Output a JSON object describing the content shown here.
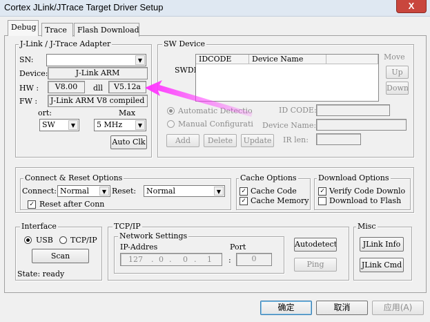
{
  "window": {
    "title": "Cortex JLink/JTrace Target Driver Setup",
    "close_glyph": "X"
  },
  "tabs": [
    {
      "label": "Debug",
      "active": true
    },
    {
      "label": "Trace",
      "active": false
    },
    {
      "label": "Flash Download",
      "active": false
    }
  ],
  "adapter": {
    "group_label": "J-Link / J-Trace Adapter",
    "sn_label": "SN:",
    "sn_value": "",
    "device_label": "Device:",
    "device_value": "J-Link ARM",
    "hw_label": "HW :",
    "hw_value": "V8.00",
    "dll_label": "dll",
    "dll_value": "V5.12a",
    "fw_label": "FW :",
    "fw_value": "J-Link ARM V8 compiled I",
    "port_label": "ort:",
    "port_value": "SW",
    "max_label": "Max",
    "max_value": "5 MHz",
    "auto_clk": "Auto Clk"
  },
  "sw_device": {
    "group_label": "SW Device",
    "swdio_label": "SWDI(",
    "columns": [
      "IDCODE",
      "Device Name"
    ],
    "move_label": "Move",
    "up_button": "Up",
    "down_button": "Down",
    "automatic_detection": "Automatic Detectio",
    "manual_configuration": "Manual Configurati",
    "detection_mode": "automatic",
    "idcode_label": "ID CODE:",
    "device_name_label": "Device Name:",
    "ir_len_label": "IR len:",
    "add_button": "Add",
    "delete_button": "Delete",
    "update_button": "Update"
  },
  "connect": {
    "group_label": "Connect & Reset Options",
    "connect_label": "Connect:",
    "connect_value": "Normal",
    "reset_label": "Reset:",
    "reset_value": "Normal",
    "reset_after_connect": "Reset after Conn",
    "reset_after_connect_checked": true
  },
  "cache": {
    "group_label": "Cache Options",
    "cache_code": "Cache Code",
    "cache_code_checked": true,
    "cache_memory": "Cache Memory",
    "cache_memory_checked": true
  },
  "download": {
    "group_label": "Download Options",
    "verify": "Verify Code Downlo",
    "verify_checked": true,
    "download_to_flash": "Download to Flash",
    "download_to_flash_checked": false
  },
  "interface": {
    "group_label": "Interface",
    "usb": "USB",
    "tcpip": "TCP/IP",
    "selected": "USB",
    "scan": "Scan",
    "state": "State: ready"
  },
  "tcpip": {
    "group_label": "TCP/IP",
    "network_label": "Network Settings",
    "ip_label": "IP-Addres",
    "ip_octets": [
      "127",
      "0",
      "0",
      "1"
    ],
    "port_label": "Port",
    "port_value": "0",
    "port_sep": ":",
    "autodetect": "Autodetect",
    "ping": "Ping"
  },
  "misc": {
    "group_label": "Misc",
    "jlink_info": "JLink Info",
    "jlink_cmd": "JLink Cmd"
  },
  "footer": {
    "ok": "确定",
    "cancel": "取消",
    "apply": "应用(A)"
  },
  "annotation": {
    "arrow_color": "#ff33ff"
  }
}
